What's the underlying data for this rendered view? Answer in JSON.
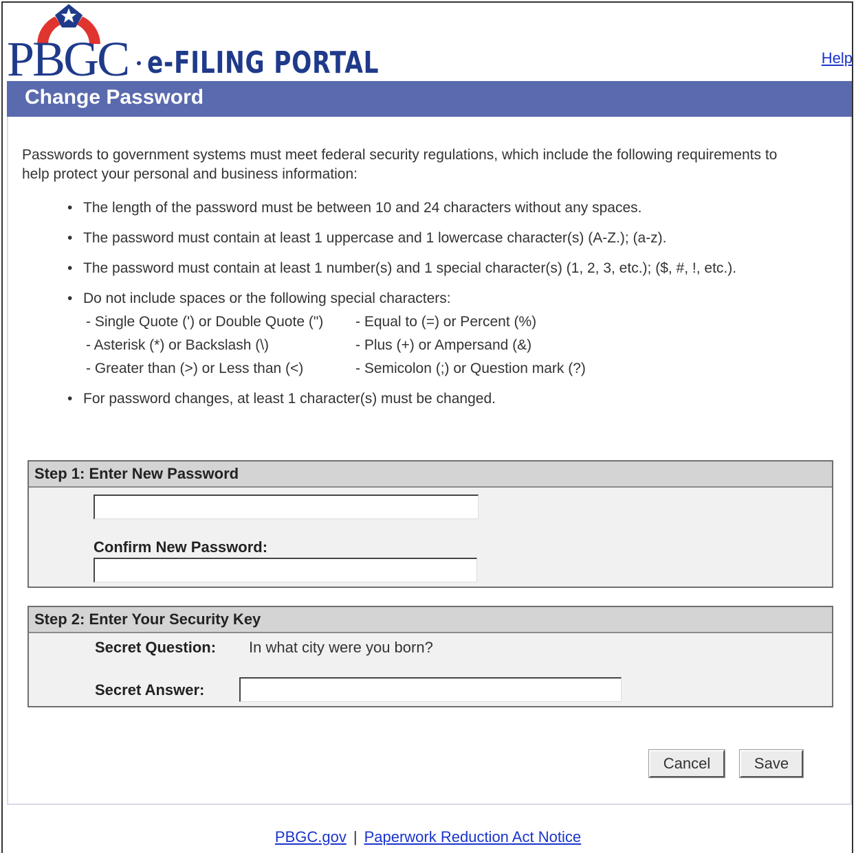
{
  "header": {
    "logo_text": "PBGC",
    "portal_title": "e-FILING PORTAL",
    "help_link": "Help"
  },
  "page": {
    "title": "Change Password",
    "intro": "Passwords to government systems must meet federal security regulations, which include the following requirements to help protect your personal and business information:"
  },
  "rules": {
    "length": "The length of the password must be between 10 and 24 characters without any spaces.",
    "case": "The password must contain at least 1 uppercase and 1 lowercase character(s) (A-Z.); (a-z).",
    "number_special": "The password must contain at least 1 number(s) and 1 special character(s) (1, 2, 3, etc.); ($, #, !, etc.).",
    "excluded_intro": "Do not include spaces or the following special characters:",
    "excluded": [
      "- Single Quote (') or Double Quote (\")",
      "- Equal to (=) or Percent (%)",
      "- Asterisk (*) or Backslash (\\)",
      "- Plus (+) or Ampersand (&)",
      "- Greater than (>) or Less than (<)",
      "- Semicolon (;) or Question mark (?)"
    ],
    "changes": "For password changes, at least 1 character(s) must be changed."
  },
  "step1": {
    "heading": "Step 1: Enter New Password",
    "new_password_value": "",
    "confirm_label": "Confirm New Password:",
    "confirm_value": ""
  },
  "step2": {
    "heading": "Step 2: Enter Your Security Key",
    "question_label": "Secret Question:",
    "question_value": "In what city were you born?",
    "answer_label": "Secret Answer:",
    "answer_value": ""
  },
  "buttons": {
    "cancel": "Cancel",
    "save": "Save"
  },
  "footer": {
    "pbgc_link": "PBGC.gov",
    "separator": "|",
    "paperwork_link": "Paperwork Reduction Act Notice"
  },
  "colors": {
    "title_bar": "#5a6aae",
    "brand_blue": "#1f3a8a",
    "brand_red": "#e0342f",
    "link": "#1a34cc"
  }
}
